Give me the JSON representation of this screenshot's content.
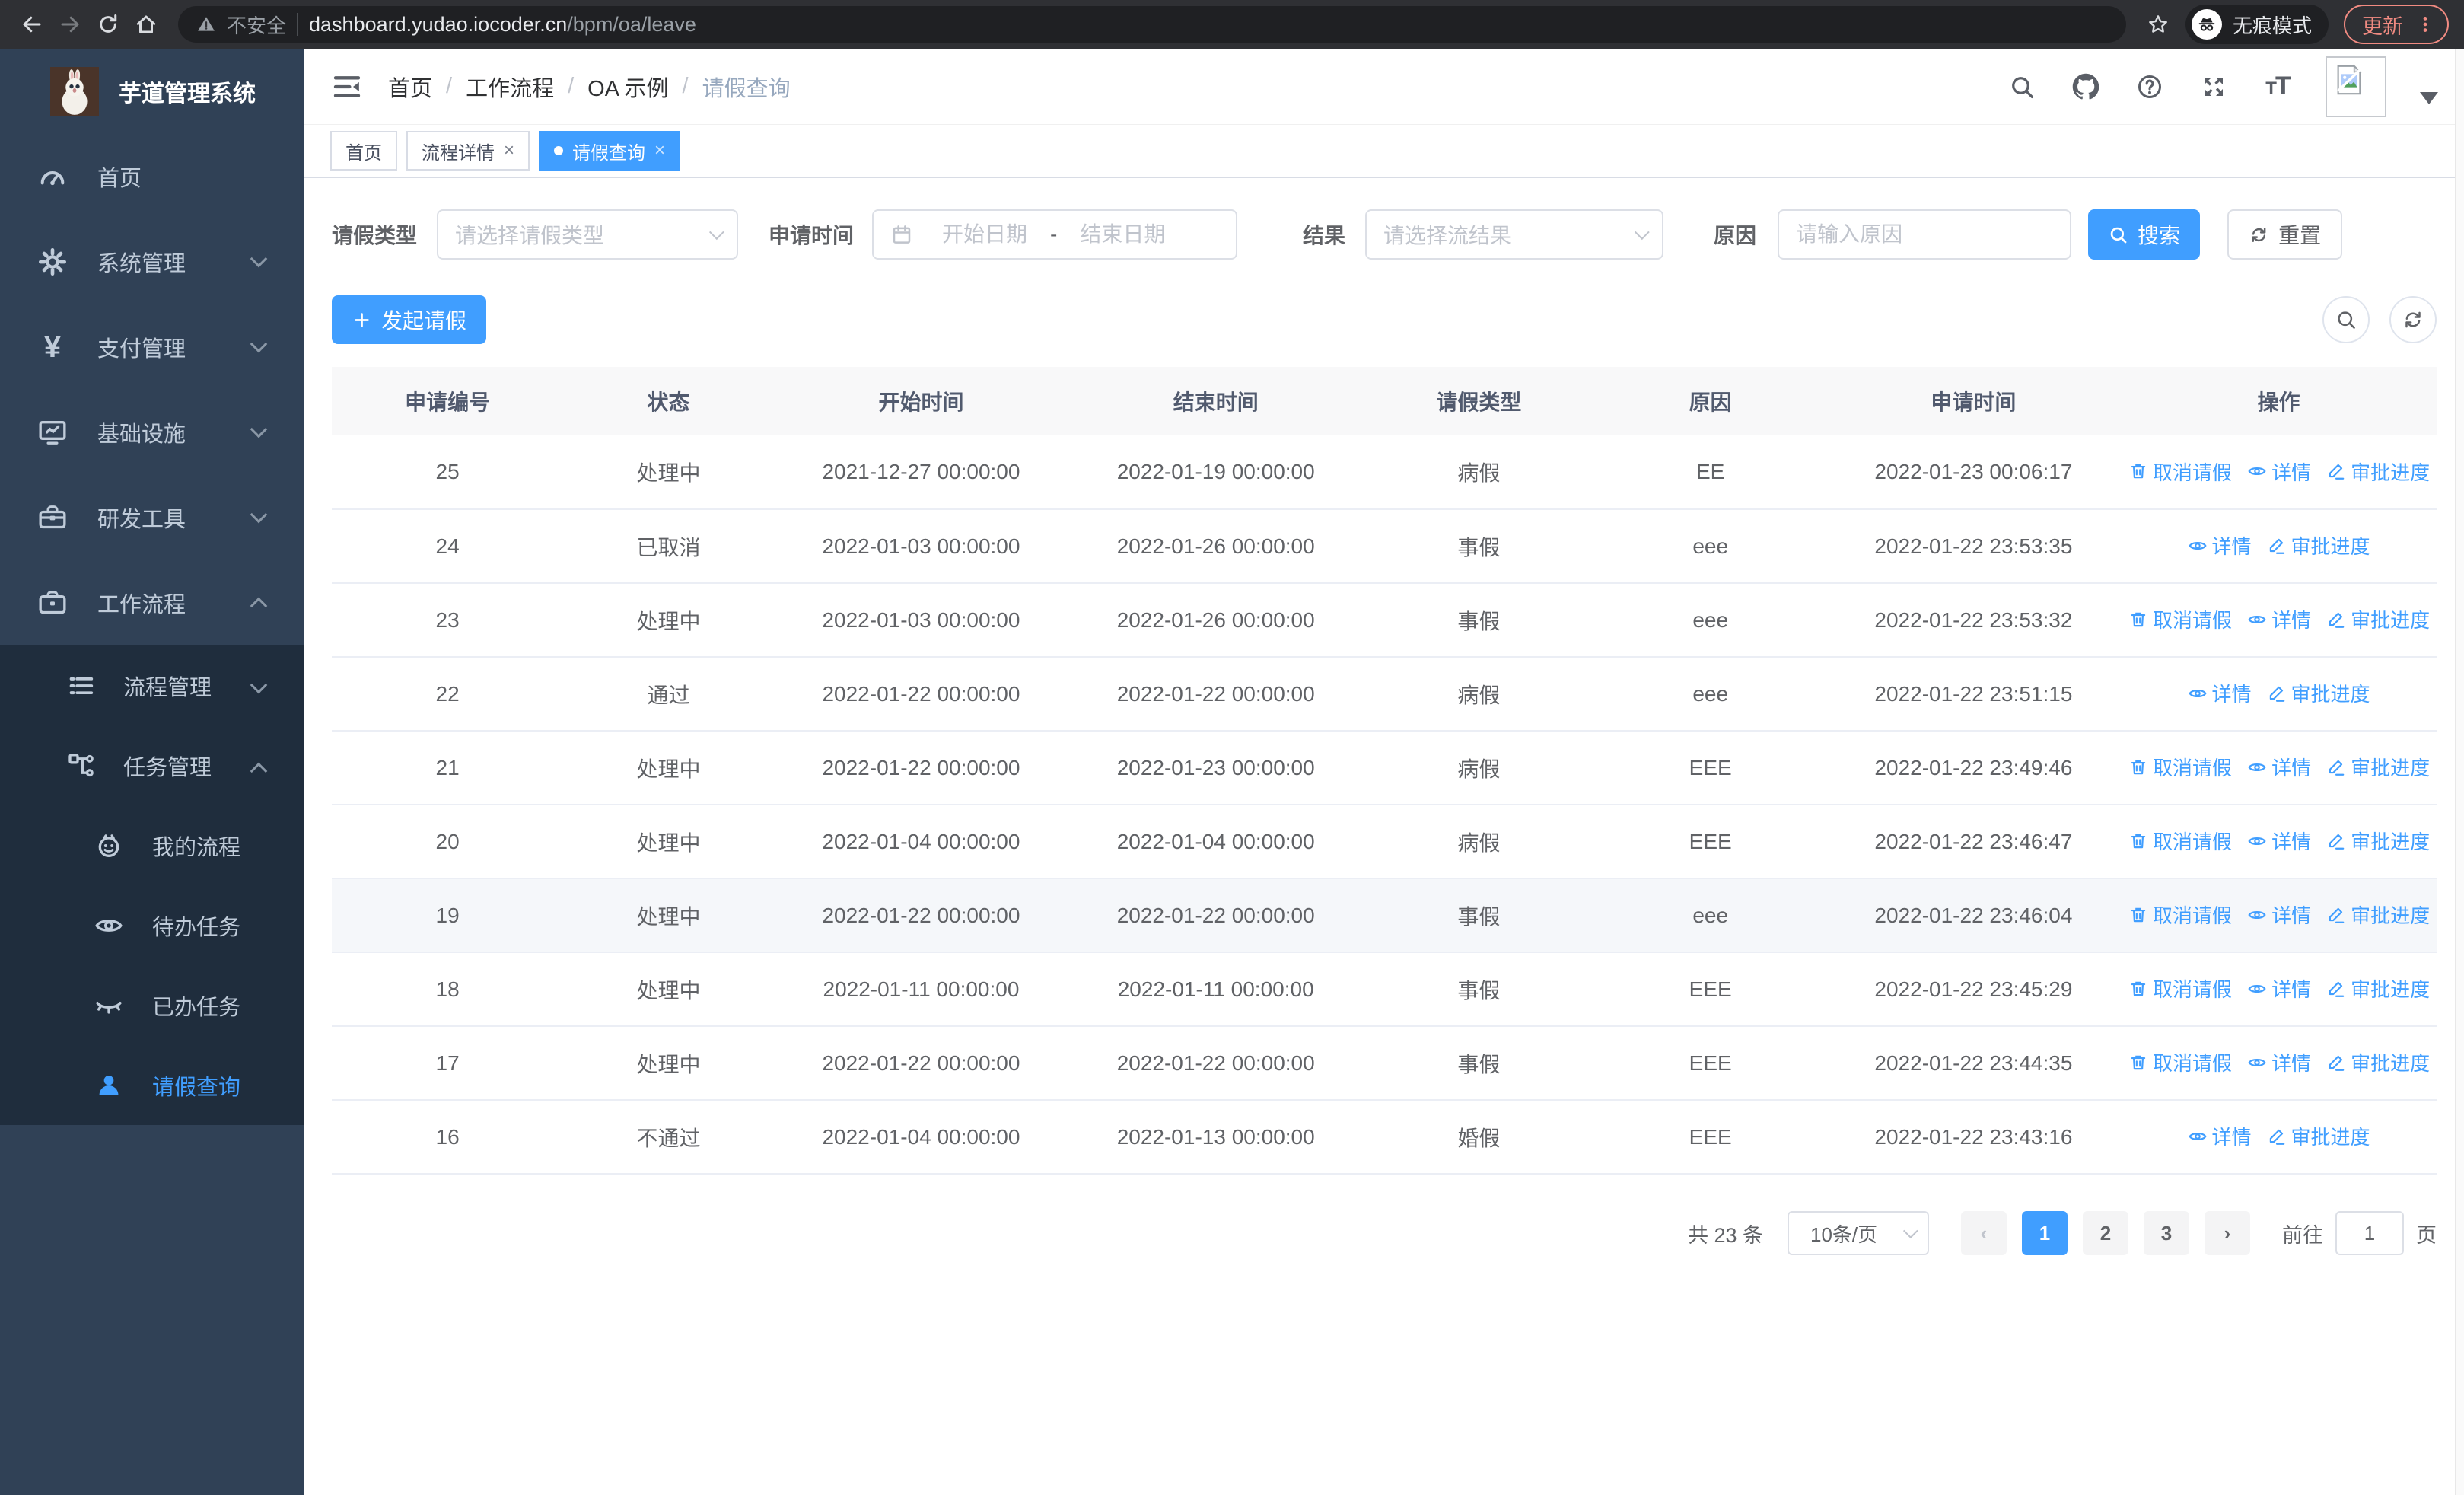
{
  "colors": {
    "primary": "#409EFF",
    "sidebar_bg": "#304156",
    "submenu_bg": "#1F2D3D",
    "update_accent": "#F28B82"
  },
  "browser": {
    "security_label": "不安全",
    "url_host": "dashboard.yudao.iocoder.cn",
    "url_path": "/bpm/oa/leave",
    "incognito_label": "无痕模式",
    "update_label": "更新"
  },
  "sidebar": {
    "app_title": "芋道管理系统",
    "items": [
      {
        "icon": "dashboard-icon",
        "label": "首页",
        "level": 1
      },
      {
        "icon": "gear-icon",
        "label": "系统管理",
        "level": 1,
        "chevron": "down"
      },
      {
        "icon": "yen-icon",
        "label": "支付管理",
        "level": 1,
        "chevron": "down"
      },
      {
        "icon": "monitor-icon",
        "label": "基础设施",
        "level": 1,
        "chevron": "down"
      },
      {
        "icon": "toolbox-icon",
        "label": "研发工具",
        "level": 1,
        "chevron": "down"
      },
      {
        "icon": "briefcase-icon",
        "label": "工作流程",
        "level": 1,
        "chevron": "up"
      },
      {
        "icon": "list-icon",
        "label": "流程管理",
        "level": 2,
        "chevron": "down",
        "sub": true
      },
      {
        "icon": "tree-icon",
        "label": "任务管理",
        "level": 2,
        "chevron": "up",
        "sub": true
      },
      {
        "icon": "robot-icon",
        "label": "我的流程",
        "level": 3,
        "sub": true
      },
      {
        "icon": "eye-open-icon",
        "label": "待办任务",
        "level": 3,
        "sub": true
      },
      {
        "icon": "eye-closed-icon",
        "label": "已办任务",
        "level": 3,
        "sub": true
      },
      {
        "icon": "person-icon",
        "label": "请假查询",
        "level": 3,
        "sub": true,
        "active": true
      }
    ]
  },
  "breadcrumb": {
    "separator": "/",
    "items": [
      "首页",
      "工作流程",
      "OA 示例",
      "请假查询"
    ]
  },
  "tabs": [
    {
      "label": "首页",
      "closable": false,
      "active": false
    },
    {
      "label": "流程详情",
      "closable": true,
      "active": false
    },
    {
      "label": "请假查询",
      "closable": true,
      "active": true
    }
  ],
  "filters": {
    "leave_type": {
      "label": "请假类型",
      "placeholder": "请选择请假类型"
    },
    "apply_time": {
      "label": "申请时间",
      "start_placeholder": "开始日期",
      "separator": "-",
      "end_placeholder": "结束日期"
    },
    "result": {
      "label": "结果",
      "placeholder": "请选择流结果"
    },
    "reason": {
      "label": "原因",
      "placeholder": "请输入原因"
    },
    "search_label": "搜索",
    "reset_label": "重置"
  },
  "toolbar": {
    "create_label": "发起请假"
  },
  "table": {
    "columns": [
      "申请编号",
      "状态",
      "开始时间",
      "结束时间",
      "请假类型",
      "原因",
      "申请时间",
      "操作"
    ],
    "action_labels": {
      "cancel": "取消请假",
      "detail": "详情",
      "progress": "审批进度"
    },
    "rows": [
      {
        "id": "25",
        "status": "处理中",
        "start": "2021-12-27 00:00:00",
        "end": "2022-01-19 00:00:00",
        "type": "病假",
        "reason": "EE",
        "apply": "2022-01-23 00:06:17",
        "cancel": true
      },
      {
        "id": "24",
        "status": "已取消",
        "start": "2022-01-03 00:00:00",
        "end": "2022-01-26 00:00:00",
        "type": "事假",
        "reason": "eee",
        "apply": "2022-01-22 23:53:35",
        "cancel": false
      },
      {
        "id": "23",
        "status": "处理中",
        "start": "2022-01-03 00:00:00",
        "end": "2022-01-26 00:00:00",
        "type": "事假",
        "reason": "eee",
        "apply": "2022-01-22 23:53:32",
        "cancel": true
      },
      {
        "id": "22",
        "status": "通过",
        "start": "2022-01-22 00:00:00",
        "end": "2022-01-22 00:00:00",
        "type": "病假",
        "reason": "eee",
        "apply": "2022-01-22 23:51:15",
        "cancel": false
      },
      {
        "id": "21",
        "status": "处理中",
        "start": "2022-01-22 00:00:00",
        "end": "2022-01-23 00:00:00",
        "type": "病假",
        "reason": "EEE",
        "apply": "2022-01-22 23:49:46",
        "cancel": true
      },
      {
        "id": "20",
        "status": "处理中",
        "start": "2022-01-04 00:00:00",
        "end": "2022-01-04 00:00:00",
        "type": "病假",
        "reason": "EEE",
        "apply": "2022-01-22 23:46:47",
        "cancel": true
      },
      {
        "id": "19",
        "status": "处理中",
        "start": "2022-01-22 00:00:00",
        "end": "2022-01-22 00:00:00",
        "type": "事假",
        "reason": "eee",
        "apply": "2022-01-22 23:46:04",
        "cancel": true,
        "hover": true
      },
      {
        "id": "18",
        "status": "处理中",
        "start": "2022-01-11 00:00:00",
        "end": "2022-01-11 00:00:00",
        "type": "事假",
        "reason": "EEE",
        "apply": "2022-01-22 23:45:29",
        "cancel": true
      },
      {
        "id": "17",
        "status": "处理中",
        "start": "2022-01-22 00:00:00",
        "end": "2022-01-22 00:00:00",
        "type": "事假",
        "reason": "EEE",
        "apply": "2022-01-22 23:44:35",
        "cancel": true
      },
      {
        "id": "16",
        "status": "不通过",
        "start": "2022-01-04 00:00:00",
        "end": "2022-01-13 00:00:00",
        "type": "婚假",
        "reason": "EEE",
        "apply": "2022-01-22 23:43:16",
        "cancel": false
      }
    ]
  },
  "pagination": {
    "total_text": "共 23 条",
    "page_size": "10条/页",
    "pages": [
      "1",
      "2",
      "3"
    ],
    "active_page": "1",
    "goto_label": "前往",
    "goto_value": "1",
    "goto_suffix": "页"
  }
}
